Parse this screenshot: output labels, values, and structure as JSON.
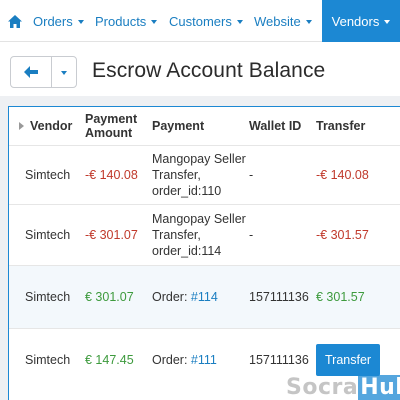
{
  "nav": {
    "items": [
      {
        "label": "Orders"
      },
      {
        "label": "Products"
      },
      {
        "label": "Customers"
      },
      {
        "label": "Website"
      },
      {
        "label": "Vendors"
      }
    ],
    "active": "Vendors"
  },
  "toolbar": {
    "title": "Escrow Account Balance"
  },
  "table": {
    "columns": [
      "Vendor",
      "Payment Amount",
      "Payment",
      "Wallet ID",
      "Transfer"
    ],
    "rows": [
      {
        "vendor": "Simtech",
        "amount": "-€ 140.08",
        "payment": "Mangopay Seller Transfer, order_id:110",
        "wallet": "-",
        "transfer": "-€ 140.08"
      },
      {
        "vendor": "Simtech",
        "amount": "-€ 301.07",
        "payment": "Mangopay Seller Transfer, order_id:114",
        "wallet": "-",
        "transfer": "-€ 301.57"
      },
      {
        "vendor": "Simtech",
        "amount": "€ 301.07",
        "payment_prefix": "Order: ",
        "payment_link": "#114",
        "wallet": "157111136",
        "transfer": "€ 301.57"
      },
      {
        "vendor": "Simtech",
        "amount": "€ 147.45",
        "payment_prefix": "Order: ",
        "payment_link": "#111",
        "wallet": "157111136",
        "transfer_button": "Transfer"
      }
    ]
  },
  "watermark": {
    "part1": "Socra",
    "part2": "Hub"
  },
  "colors": {
    "accent": "#1c88d3",
    "negative": "#c0392b",
    "positive": "#3d9a3d"
  }
}
